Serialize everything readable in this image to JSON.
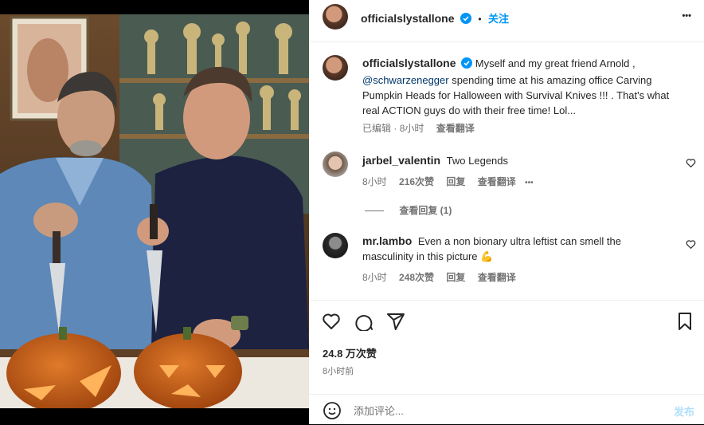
{
  "header": {
    "username": "officialslystallone",
    "separator": "•",
    "follow_label": "关注",
    "more_label": "•••"
  },
  "caption": {
    "username": "officialslystallone",
    "text_1": "Myself and my great friend Arnold ,",
    "mention": "@schwarzenegger",
    "text_2": " spending time at his amazing office Carving Pumpkin Heads for Halloween with Survival Knives !!! . That's what real ACTION guys do with their free time! Lol...",
    "edited": "已编辑",
    "sep": "·",
    "time": "8小时",
    "translate": "查看翻译"
  },
  "comments": [
    {
      "username": "jarbel_valentin",
      "text": "Two Legends",
      "time": "8小时",
      "likes": "216次赞",
      "reply": "回复",
      "translate": "查看翻译",
      "more": "•••",
      "view_replies": "查看回复 (1)"
    },
    {
      "username": "mr.lambo",
      "text": "Even a non bionary ultra leftist can smell the masculinity in this picture 💪",
      "time": "8小时",
      "likes": "248次赞",
      "reply": "回复",
      "translate": "查看翻译"
    }
  ],
  "stats": {
    "likes": "24.8 万次赞",
    "time": "8小时前"
  },
  "composer": {
    "placeholder": "添加评论...",
    "post_label": "发布"
  },
  "colors": {
    "accent": "#0095f6",
    "verified": "#0095f6",
    "text": "#262626",
    "muted": "#737373",
    "post_disabled": "#b2dffc"
  },
  "icons": [
    "verified-icon",
    "more-icon",
    "heart-icon",
    "comment-icon",
    "share-icon",
    "bookmark-icon",
    "emoji-icon"
  ]
}
